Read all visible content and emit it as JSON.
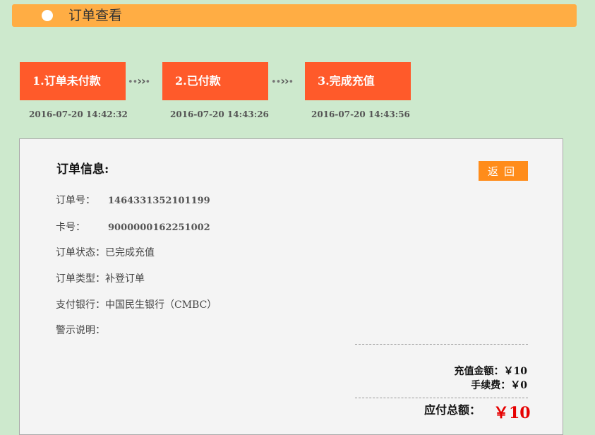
{
  "header": {
    "title": "订单查看"
  },
  "steps": [
    {
      "label": "1.订单未付款",
      "time": "2016-07-20 14:42:32"
    },
    {
      "label": "2.已付款",
      "time": "2016-07-20 14:43:26"
    },
    {
      "label": "3.完成充值",
      "time": "2016-07-20 14:43:56"
    }
  ],
  "panel": {
    "title": "订单信息:",
    "back_label": "返回",
    "fields": {
      "order_no": {
        "label": "订单号：",
        "value": "1464331352101199"
      },
      "card_no": {
        "label": "卡号：",
        "value": "9000000162251002"
      },
      "status": {
        "label": "订单状态：",
        "value": "已完成充值"
      },
      "type": {
        "label": "订单类型：",
        "value": "补登订单"
      },
      "bank": {
        "label": "支付银行：",
        "value": "中国民生银行（CMBC）"
      },
      "warning": {
        "label": "警示说明：",
        "value": ""
      }
    },
    "summary": {
      "recharge": "充值金额：￥10",
      "fee": "手续费：￥0",
      "total_label": "应付总额：",
      "total_value": "￥10"
    }
  }
}
